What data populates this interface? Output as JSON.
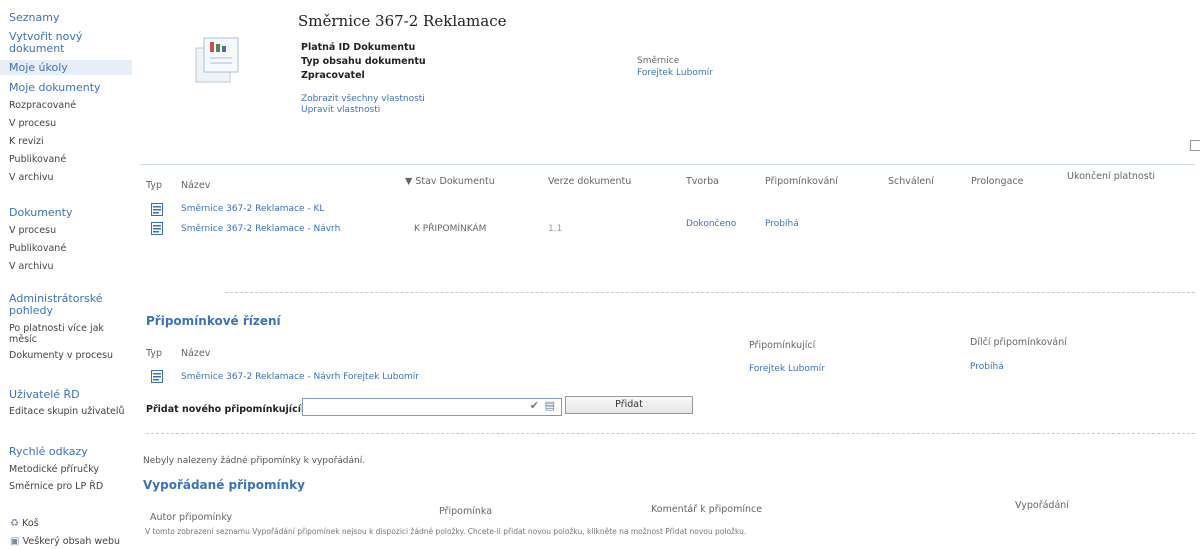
{
  "sidebar": {
    "links_top": [
      "Seznamy",
      "Vytvořit nový dokument",
      "Moje úkoly",
      "Moje dokumenty"
    ],
    "my_docs": [
      "Rozpracované",
      "V procesu",
      "K revizi",
      "Publikované",
      "V archivu"
    ],
    "docs_heading": "Dokumenty",
    "docs": [
      "V procesu",
      "Publikované",
      "V archivu"
    ],
    "admin_heading": "Administrátorské pohledy",
    "admin": [
      "Po platnosti více jak měsíc",
      "Dokumenty v procesu"
    ],
    "users_heading": "Uživatelé ŘD",
    "users": [
      "Editace skupin uživatelů"
    ],
    "quick_heading": "Rychlé odkazy",
    "quick": [
      "Metodické příručky",
      "Směrnice pro LP ŘD"
    ],
    "bottom": [
      "Koš",
      "Veškerý obsah webu"
    ]
  },
  "header": {
    "title": "Směrnice 367-2 Reklamace",
    "props": [
      "Platná ID Dokumentu",
      "Typ obsahu dokumentu",
      "Zpracovatel"
    ],
    "show_all": "Zobrazit všechny vlastnosti",
    "edit_props": "Upravit vlastnosti",
    "smernice_label": "Směrnice",
    "smernice_value": "Forejtek Lubomír"
  },
  "docs_table": {
    "columns": [
      "Typ",
      "Název",
      "Stav Dokumentu",
      "Verze dokumentu",
      "Tvorba",
      "Připomínkování",
      "Schválení",
      "Prolongace",
      "Ukončení platnosti"
    ],
    "rows": [
      {
        "name": "Směrnice 367-2 Reklamace - KL",
        "stav": "",
        "verze": "",
        "tvorba": "",
        "pripom": ""
      },
      {
        "name": "Směrnice 367-2 Reklamace - Návrh",
        "stav": "K PŘIPOMÍNKÁM",
        "verze": "1.1",
        "tvorba": "Dokončeno",
        "pripom": "Probíhá"
      }
    ]
  },
  "comment_process": {
    "heading": "Připomínkové řízení",
    "columns": [
      "Typ",
      "Název",
      "Připomínkující",
      "Dílčí připomínkování"
    ],
    "row": {
      "name": "Směrnice 367-2 Reklamace - Návrh Forejtek Lubomír",
      "reviewer": "Forejtek Lubomír",
      "state": "Probíhá"
    },
    "add_label": "Přidat nového připomínkujícího:",
    "add_button": "Přidat",
    "input_value": ""
  },
  "no_comments": "Nebyly nalezeny žádné připomínky k vypořádání.",
  "resolved": {
    "heading": "Vypořádané připomínky",
    "columns": [
      "Autor připomínky",
      "Připomínka",
      "Komentář k připomínce",
      "Vypořádání"
    ],
    "empty_text": "V tomto zobrazení seznamu Vypořádání připomínek nejsou k dispozici žádné položky. Chcete-li přidat novou položku, klikněte na možnost Přidat novou položku."
  }
}
